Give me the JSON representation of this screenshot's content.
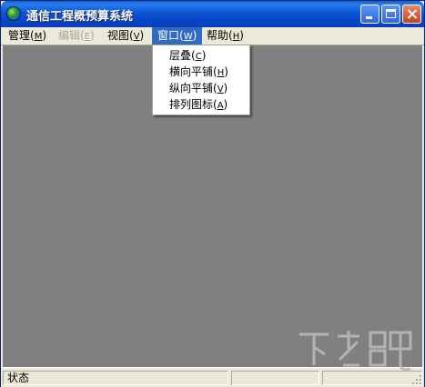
{
  "window": {
    "title": "通信工程概预算系统"
  },
  "menubar": {
    "items": [
      {
        "label": "管理",
        "key": "M",
        "state": "normal"
      },
      {
        "label": "编辑",
        "key": "E",
        "state": "disabled"
      },
      {
        "label": "视图",
        "key": "V",
        "state": "normal"
      },
      {
        "label": "窗口",
        "key": "W",
        "state": "active"
      },
      {
        "label": "帮助",
        "key": "H",
        "state": "normal"
      }
    ]
  },
  "window_menu": {
    "items": [
      {
        "label": "层叠",
        "key": "C"
      },
      {
        "label": "横向平铺",
        "key": "H"
      },
      {
        "label": "纵向平铺",
        "key": "V"
      },
      {
        "label": "排列图标",
        "key": "A"
      }
    ]
  },
  "statusbar": {
    "text": "状态"
  },
  "colors": {
    "titlebar": "#0b55d4",
    "menu_highlight": "#316ac5",
    "client_bg": "#808080",
    "chrome": "#ece9d8"
  }
}
